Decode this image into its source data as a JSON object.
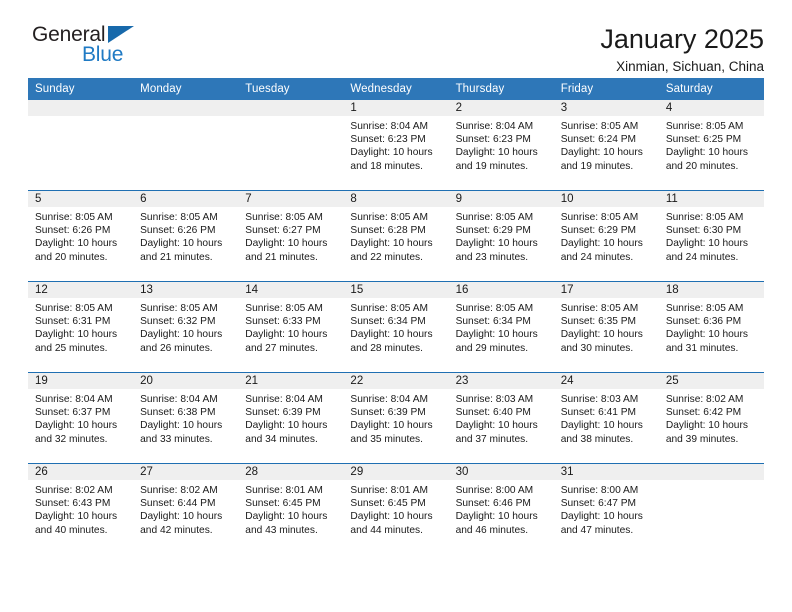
{
  "brand": {
    "name_part1": "General",
    "name_part2": "Blue",
    "triangle_icon": "triangle-icon",
    "accent_color": "#1f7ac4"
  },
  "header": {
    "title": "January 2025",
    "subtitle": "Xinmian, Sichuan, China"
  },
  "colors": {
    "header_blue": "#2e77b8",
    "row_divider_blue": "#1f6fb2",
    "daynum_band": "#efefef",
    "text": "#1a1a1a"
  },
  "calendar": {
    "weekdays": [
      "Sunday",
      "Monday",
      "Tuesday",
      "Wednesday",
      "Thursday",
      "Friday",
      "Saturday"
    ],
    "weeks": [
      [
        {
          "day": "",
          "blank": true
        },
        {
          "day": "",
          "blank": true
        },
        {
          "day": "",
          "blank": true
        },
        {
          "day": "1",
          "sunrise": "Sunrise: 8:04 AM",
          "sunset": "Sunset: 6:23 PM",
          "daylight1": "Daylight: 10 hours",
          "daylight2": "and 18 minutes."
        },
        {
          "day": "2",
          "sunrise": "Sunrise: 8:04 AM",
          "sunset": "Sunset: 6:23 PM",
          "daylight1": "Daylight: 10 hours",
          "daylight2": "and 19 minutes."
        },
        {
          "day": "3",
          "sunrise": "Sunrise: 8:05 AM",
          "sunset": "Sunset: 6:24 PM",
          "daylight1": "Daylight: 10 hours",
          "daylight2": "and 19 minutes."
        },
        {
          "day": "4",
          "sunrise": "Sunrise: 8:05 AM",
          "sunset": "Sunset: 6:25 PM",
          "daylight1": "Daylight: 10 hours",
          "daylight2": "and 20 minutes."
        }
      ],
      [
        {
          "day": "5",
          "sunrise": "Sunrise: 8:05 AM",
          "sunset": "Sunset: 6:26 PM",
          "daylight1": "Daylight: 10 hours",
          "daylight2": "and 20 minutes."
        },
        {
          "day": "6",
          "sunrise": "Sunrise: 8:05 AM",
          "sunset": "Sunset: 6:26 PM",
          "daylight1": "Daylight: 10 hours",
          "daylight2": "and 21 minutes."
        },
        {
          "day": "7",
          "sunrise": "Sunrise: 8:05 AM",
          "sunset": "Sunset: 6:27 PM",
          "daylight1": "Daylight: 10 hours",
          "daylight2": "and 21 minutes."
        },
        {
          "day": "8",
          "sunrise": "Sunrise: 8:05 AM",
          "sunset": "Sunset: 6:28 PM",
          "daylight1": "Daylight: 10 hours",
          "daylight2": "and 22 minutes."
        },
        {
          "day": "9",
          "sunrise": "Sunrise: 8:05 AM",
          "sunset": "Sunset: 6:29 PM",
          "daylight1": "Daylight: 10 hours",
          "daylight2": "and 23 minutes."
        },
        {
          "day": "10",
          "sunrise": "Sunrise: 8:05 AM",
          "sunset": "Sunset: 6:29 PM",
          "daylight1": "Daylight: 10 hours",
          "daylight2": "and 24 minutes."
        },
        {
          "day": "11",
          "sunrise": "Sunrise: 8:05 AM",
          "sunset": "Sunset: 6:30 PM",
          "daylight1": "Daylight: 10 hours",
          "daylight2": "and 24 minutes."
        }
      ],
      [
        {
          "day": "12",
          "sunrise": "Sunrise: 8:05 AM",
          "sunset": "Sunset: 6:31 PM",
          "daylight1": "Daylight: 10 hours",
          "daylight2": "and 25 minutes."
        },
        {
          "day": "13",
          "sunrise": "Sunrise: 8:05 AM",
          "sunset": "Sunset: 6:32 PM",
          "daylight1": "Daylight: 10 hours",
          "daylight2": "and 26 minutes."
        },
        {
          "day": "14",
          "sunrise": "Sunrise: 8:05 AM",
          "sunset": "Sunset: 6:33 PM",
          "daylight1": "Daylight: 10 hours",
          "daylight2": "and 27 minutes."
        },
        {
          "day": "15",
          "sunrise": "Sunrise: 8:05 AM",
          "sunset": "Sunset: 6:34 PM",
          "daylight1": "Daylight: 10 hours",
          "daylight2": "and 28 minutes."
        },
        {
          "day": "16",
          "sunrise": "Sunrise: 8:05 AM",
          "sunset": "Sunset: 6:34 PM",
          "daylight1": "Daylight: 10 hours",
          "daylight2": "and 29 minutes."
        },
        {
          "day": "17",
          "sunrise": "Sunrise: 8:05 AM",
          "sunset": "Sunset: 6:35 PM",
          "daylight1": "Daylight: 10 hours",
          "daylight2": "and 30 minutes."
        },
        {
          "day": "18",
          "sunrise": "Sunrise: 8:05 AM",
          "sunset": "Sunset: 6:36 PM",
          "daylight1": "Daylight: 10 hours",
          "daylight2": "and 31 minutes."
        }
      ],
      [
        {
          "day": "19",
          "sunrise": "Sunrise: 8:04 AM",
          "sunset": "Sunset: 6:37 PM",
          "daylight1": "Daylight: 10 hours",
          "daylight2": "and 32 minutes."
        },
        {
          "day": "20",
          "sunrise": "Sunrise: 8:04 AM",
          "sunset": "Sunset: 6:38 PM",
          "daylight1": "Daylight: 10 hours",
          "daylight2": "and 33 minutes."
        },
        {
          "day": "21",
          "sunrise": "Sunrise: 8:04 AM",
          "sunset": "Sunset: 6:39 PM",
          "daylight1": "Daylight: 10 hours",
          "daylight2": "and 34 minutes."
        },
        {
          "day": "22",
          "sunrise": "Sunrise: 8:04 AM",
          "sunset": "Sunset: 6:39 PM",
          "daylight1": "Daylight: 10 hours",
          "daylight2": "and 35 minutes."
        },
        {
          "day": "23",
          "sunrise": "Sunrise: 8:03 AM",
          "sunset": "Sunset: 6:40 PM",
          "daylight1": "Daylight: 10 hours",
          "daylight2": "and 37 minutes."
        },
        {
          "day": "24",
          "sunrise": "Sunrise: 8:03 AM",
          "sunset": "Sunset: 6:41 PM",
          "daylight1": "Daylight: 10 hours",
          "daylight2": "and 38 minutes."
        },
        {
          "day": "25",
          "sunrise": "Sunrise: 8:02 AM",
          "sunset": "Sunset: 6:42 PM",
          "daylight1": "Daylight: 10 hours",
          "daylight2": "and 39 minutes."
        }
      ],
      [
        {
          "day": "26",
          "sunrise": "Sunrise: 8:02 AM",
          "sunset": "Sunset: 6:43 PM",
          "daylight1": "Daylight: 10 hours",
          "daylight2": "and 40 minutes."
        },
        {
          "day": "27",
          "sunrise": "Sunrise: 8:02 AM",
          "sunset": "Sunset: 6:44 PM",
          "daylight1": "Daylight: 10 hours",
          "daylight2": "and 42 minutes."
        },
        {
          "day": "28",
          "sunrise": "Sunrise: 8:01 AM",
          "sunset": "Sunset: 6:45 PM",
          "daylight1": "Daylight: 10 hours",
          "daylight2": "and 43 minutes."
        },
        {
          "day": "29",
          "sunrise": "Sunrise: 8:01 AM",
          "sunset": "Sunset: 6:45 PM",
          "daylight1": "Daylight: 10 hours",
          "daylight2": "and 44 minutes."
        },
        {
          "day": "30",
          "sunrise": "Sunrise: 8:00 AM",
          "sunset": "Sunset: 6:46 PM",
          "daylight1": "Daylight: 10 hours",
          "daylight2": "and 46 minutes."
        },
        {
          "day": "31",
          "sunrise": "Sunrise: 8:00 AM",
          "sunset": "Sunset: 6:47 PM",
          "daylight1": "Daylight: 10 hours",
          "daylight2": "and 47 minutes."
        },
        {
          "day": "",
          "blank": true
        }
      ]
    ]
  }
}
